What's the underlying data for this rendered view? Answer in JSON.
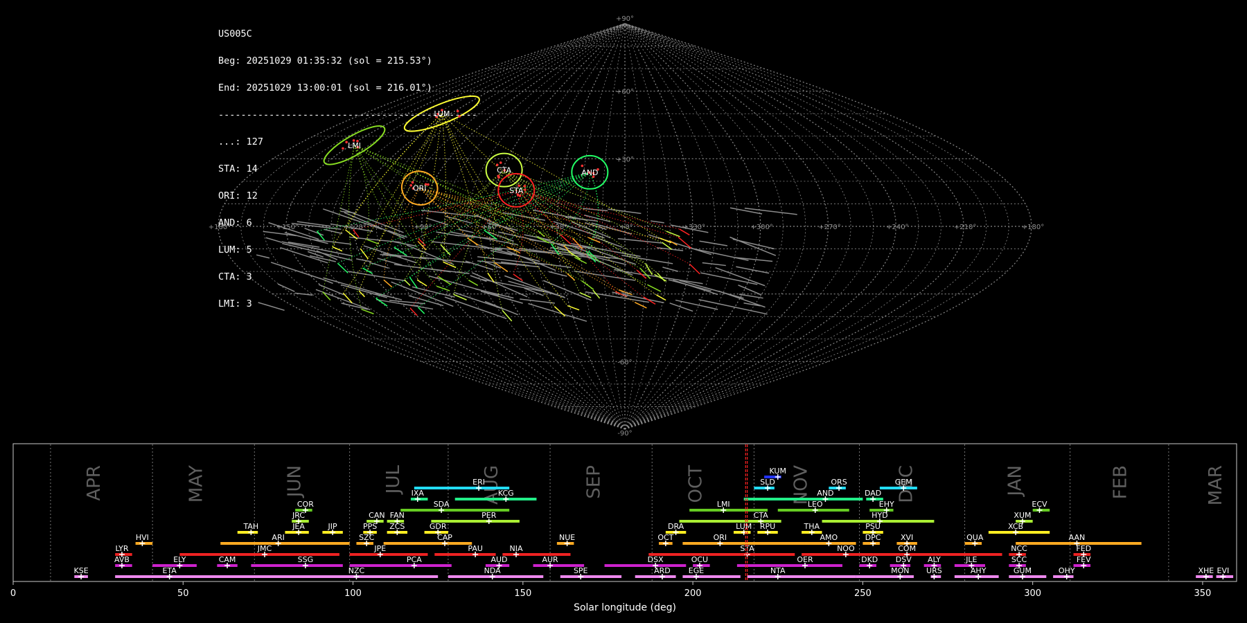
{
  "header": {
    "station": "US005C",
    "beg": "Beg: 20251029 01:35:32 (sol = 215.53°)",
    "end": "End: 20251029 13:00:01 (sol = 216.01°)",
    "divider": "----------------------------------------------",
    "counts": [
      {
        "label": "...: 127"
      },
      {
        "label": "STA: 14"
      },
      {
        "label": "ORI: 12"
      },
      {
        "label": "AND: 6"
      },
      {
        "label": "LUM: 5"
      },
      {
        "label": "CTA: 3"
      },
      {
        "label": "LMI: 3"
      }
    ]
  },
  "chart_data": [
    {
      "type": "scatter",
      "projection": "sinusoidal",
      "lon_ticks": [
        "+180°",
        "+150°",
        "+120°",
        "+90°",
        "+60°",
        "+30°",
        "+0°",
        "+330°",
        "+300°",
        "+270°",
        "+240°",
        "+210°",
        "+180°"
      ],
      "lat_ticks": [
        "+90°",
        "+60°",
        "+30°",
        "-30°",
        "-60°",
        "-90°"
      ],
      "grid": true,
      "radiants": [
        {
          "name": "LUM",
          "lon": 126,
          "lat": 50,
          "color": "#ffff33"
        },
        {
          "name": "LMI",
          "lon": 148,
          "lat": 36,
          "color": "#88dd22"
        },
        {
          "name": "ORI",
          "lon": 95,
          "lat": 17,
          "color": "#ffaa22"
        },
        {
          "name": "CTA",
          "lon": 59,
          "lat": 25,
          "color": "#ccff44"
        },
        {
          "name": "STA",
          "lon": 50,
          "lat": 16,
          "color": "#ff2222"
        },
        {
          "name": "AND",
          "lon": 17,
          "lat": 24,
          "color": "#22ff66"
        }
      ]
    },
    {
      "type": "gantt",
      "xlabel": "Solar longitude (deg)",
      "xlim": [
        0,
        360
      ],
      "xticks": [
        0,
        50,
        100,
        150,
        200,
        250,
        300,
        350
      ],
      "current_sol": [
        215.53,
        216.01
      ],
      "months": [
        {
          "name": "APR",
          "label_at": 24,
          "line_at": 11
        },
        {
          "name": "MAY",
          "label_at": 54,
          "line_at": 41
        },
        {
          "name": "JUN",
          "label_at": 83,
          "line_at": 71
        },
        {
          "name": "JUL",
          "label_at": 112,
          "line_at": 99
        },
        {
          "name": "AUG",
          "label_at": 141,
          "line_at": 128
        },
        {
          "name": "SEP",
          "label_at": 171,
          "line_at": 158
        },
        {
          "name": "OCT",
          "label_at": 201,
          "line_at": 188
        },
        {
          "name": "NOV",
          "label_at": 232,
          "line_at": 218
        },
        {
          "name": "DEC",
          "label_at": 263,
          "line_at": 249
        },
        {
          "name": "JAN",
          "label_at": 295,
          "line_at": 280
        },
        {
          "name": "FEB",
          "label_at": 326,
          "line_at": 311
        },
        {
          "name": "MAR",
          "label_at": 354,
          "line_at": 340
        }
      ],
      "showers": [
        {
          "code": "KUM",
          "start": 221,
          "end": 226,
          "peak": 225,
          "row": 9,
          "color": "#2233ff"
        },
        {
          "code": "ERI",
          "start": 118,
          "end": 146,
          "peak": 137,
          "row": 8,
          "color": "#22ddff"
        },
        {
          "code": "SLD",
          "start": 218,
          "end": 224,
          "peak": 222,
          "row": 8,
          "color": "#22ddff"
        },
        {
          "code": "ORS",
          "start": 240,
          "end": 245,
          "peak": 243,
          "row": 8,
          "color": "#22ddff"
        },
        {
          "code": "GEM",
          "start": 255,
          "end": 266,
          "peak": 262,
          "row": 8,
          "color": "#22ddff"
        },
        {
          "code": "IXA",
          "start": 117,
          "end": 122,
          "peak": 119,
          "row": 7,
          "color": "#22ee88"
        },
        {
          "code": "KCG",
          "start": 130,
          "end": 154,
          "peak": 145,
          "row": 7,
          "color": "#22ee88"
        },
        {
          "code": "AND",
          "start": 215,
          "end": 250,
          "peak": 239,
          "row": 7,
          "color": "#22ee88"
        },
        {
          "code": "DAD",
          "start": 251,
          "end": 256,
          "peak": 253,
          "row": 7,
          "color": "#22ee88"
        },
        {
          "code": "COR",
          "start": 83,
          "end": 88,
          "peak": 86,
          "row": 6,
          "color": "#66cc22"
        },
        {
          "code": "SDA",
          "start": 114,
          "end": 146,
          "peak": 126,
          "row": 6,
          "color": "#66cc22"
        },
        {
          "code": "LMI",
          "start": 199,
          "end": 222,
          "peak": 209,
          "row": 6,
          "color": "#66cc22"
        },
        {
          "code": "LEO",
          "start": 225,
          "end": 246,
          "peak": 236,
          "row": 6,
          "color": "#66cc22"
        },
        {
          "code": "EHY",
          "start": 252,
          "end": 259,
          "peak": 257,
          "row": 6,
          "color": "#66cc22"
        },
        {
          "code": "ECV",
          "start": 300,
          "end": 305,
          "peak": 302,
          "row": 6,
          "color": "#66cc22"
        },
        {
          "code": "JRC",
          "start": 82,
          "end": 87,
          "peak": 84,
          "row": 5,
          "color": "#aaee33"
        },
        {
          "code": "CAN",
          "start": 104,
          "end": 109,
          "peak": 107,
          "row": 5,
          "color": "#aaee33"
        },
        {
          "code": "FAN",
          "start": 110,
          "end": 115,
          "peak": 113,
          "row": 5,
          "color": "#aaee33"
        },
        {
          "code": "PER",
          "start": 123,
          "end": 149,
          "peak": 140,
          "row": 5,
          "color": "#aaee33"
        },
        {
          "code": "CTA",
          "start": 196,
          "end": 226,
          "peak": 220,
          "row": 5,
          "color": "#aaee33"
        },
        {
          "code": "HYD",
          "start": 238,
          "end": 271,
          "peak": 255,
          "row": 5,
          "color": "#aaee33"
        },
        {
          "code": "XUM",
          "start": 295,
          "end": 300,
          "peak": 297,
          "row": 5,
          "color": "#aaee33"
        },
        {
          "code": "TAH",
          "start": 66,
          "end": 72,
          "peak": 70,
          "row": 4,
          "color": "#ffee22"
        },
        {
          "code": "JEA",
          "start": 80,
          "end": 87,
          "peak": 84,
          "row": 4,
          "color": "#ffee22"
        },
        {
          "code": "JIP",
          "start": 91,
          "end": 97,
          "peak": 94,
          "row": 4,
          "color": "#ffee22"
        },
        {
          "code": "PPS",
          "start": 103,
          "end": 107,
          "peak": 105,
          "row": 4,
          "color": "#ffee22"
        },
        {
          "code": "ZCS",
          "start": 110,
          "end": 116,
          "peak": 113,
          "row": 4,
          "color": "#ffee22"
        },
        {
          "code": "GDR",
          "start": 121,
          "end": 128,
          "peak": 125,
          "row": 4,
          "color": "#ffee22"
        },
        {
          "code": "DRA",
          "start": 192,
          "end": 198,
          "peak": 195,
          "row": 4,
          "color": "#ffee22"
        },
        {
          "code": "LUM",
          "start": 212,
          "end": 217,
          "peak": 215,
          "row": 4,
          "color": "#ffee22"
        },
        {
          "code": "RPU",
          "start": 219,
          "end": 225,
          "peak": 222,
          "row": 4,
          "color": "#ffee22"
        },
        {
          "code": "THA",
          "start": 232,
          "end": 238,
          "peak": 235,
          "row": 4,
          "color": "#ffee22"
        },
        {
          "code": "PSU",
          "start": 250,
          "end": 256,
          "peak": 253,
          "row": 4,
          "color": "#ffee22"
        },
        {
          "code": "XCB",
          "start": 287,
          "end": 305,
          "peak": 295,
          "row": 4,
          "color": "#ffee22"
        },
        {
          "code": "HVI",
          "start": 36,
          "end": 41,
          "peak": 38,
          "row": 3,
          "color": "#ffaa22"
        },
        {
          "code": "ARI",
          "start": 61,
          "end": 99,
          "peak": 78,
          "row": 3,
          "color": "#ffaa22"
        },
        {
          "code": "SZC",
          "start": 101,
          "end": 106,
          "peak": 104,
          "row": 3,
          "color": "#ffaa22"
        },
        {
          "code": "CAP",
          "start": 109,
          "end": 135,
          "peak": 127,
          "row": 3,
          "color": "#ffaa22"
        },
        {
          "code": "NUE",
          "start": 160,
          "end": 165,
          "peak": 163,
          "row": 3,
          "color": "#ffaa22"
        },
        {
          "code": "OCT",
          "start": 190,
          "end": 194,
          "peak": 192,
          "row": 3,
          "color": "#ffaa22"
        },
        {
          "code": "ORI",
          "start": 197,
          "end": 233,
          "peak": 208,
          "row": 3,
          "color": "#ffaa22"
        },
        {
          "code": "AMO",
          "start": 233,
          "end": 248,
          "peak": 240,
          "row": 3,
          "color": "#ffaa22"
        },
        {
          "code": "DPC",
          "start": 250,
          "end": 255,
          "peak": 253,
          "row": 3,
          "color": "#ffaa22"
        },
        {
          "code": "XVI",
          "start": 260,
          "end": 266,
          "peak": 263,
          "row": 3,
          "color": "#ffaa22"
        },
        {
          "code": "QUA",
          "start": 280,
          "end": 285,
          "peak": 283,
          "row": 3,
          "color": "#ffaa22"
        },
        {
          "code": "AAN",
          "start": 295,
          "end": 332,
          "peak": 313,
          "row": 3,
          "color": "#ffaa22"
        },
        {
          "code": "LYR",
          "start": 30,
          "end": 35,
          "peak": 32,
          "row": 2,
          "color": "#ee2222"
        },
        {
          "code": "JMC",
          "start": 49,
          "end": 96,
          "peak": 74,
          "row": 2,
          "color": "#ee2222"
        },
        {
          "code": "JPE",
          "start": 99,
          "end": 122,
          "peak": 108,
          "row": 2,
          "color": "#ee2222"
        },
        {
          "code": "PAU",
          "start": 124,
          "end": 142,
          "peak": 136,
          "row": 2,
          "color": "#ee2222"
        },
        {
          "code": "NIA",
          "start": 144,
          "end": 164,
          "peak": 148,
          "row": 2,
          "color": "#ee2222"
        },
        {
          "code": "STA",
          "start": 187,
          "end": 230,
          "peak": 216,
          "row": 2,
          "color": "#ee2222"
        },
        {
          "code": "NOO",
          "start": 232,
          "end": 253,
          "peak": 245,
          "row": 2,
          "color": "#ee2222"
        },
        {
          "code": "COM",
          "start": 253,
          "end": 291,
          "peak": 263,
          "row": 2,
          "color": "#ee2222"
        },
        {
          "code": "NCC",
          "start": 293,
          "end": 298,
          "peak": 296,
          "row": 2,
          "color": "#ee2222"
        },
        {
          "code": "FED",
          "start": 312,
          "end": 317,
          "peak": 315,
          "row": 2,
          "color": "#ee2222"
        },
        {
          "code": "AVB",
          "start": 30,
          "end": 35,
          "peak": 32,
          "row": 1,
          "color": "#cc22cc"
        },
        {
          "code": "ELY",
          "start": 41,
          "end": 54,
          "peak": 49,
          "row": 1,
          "color": "#cc22cc"
        },
        {
          "code": "CAM",
          "start": 60,
          "end": 66,
          "peak": 63,
          "row": 1,
          "color": "#cc22cc"
        },
        {
          "code": "SSG",
          "start": 70,
          "end": 97,
          "peak": 86,
          "row": 1,
          "color": "#cc22cc"
        },
        {
          "code": "PCA",
          "start": 99,
          "end": 129,
          "peak": 118,
          "row": 1,
          "color": "#cc22cc"
        },
        {
          "code": "AUD",
          "start": 139,
          "end": 146,
          "peak": 143,
          "row": 1,
          "color": "#cc22cc"
        },
        {
          "code": "AUR",
          "start": 153,
          "end": 168,
          "peak": 158,
          "row": 1,
          "color": "#cc22cc"
        },
        {
          "code": "DSX",
          "start": 174,
          "end": 198,
          "peak": 189,
          "row": 1,
          "color": "#cc22cc"
        },
        {
          "code": "OCU",
          "start": 200,
          "end": 205,
          "peak": 202,
          "row": 1,
          "color": "#cc22cc"
        },
        {
          "code": "OER",
          "start": 213,
          "end": 244,
          "peak": 233,
          "row": 1,
          "color": "#cc22cc"
        },
        {
          "code": "DKD",
          "start": 249,
          "end": 254,
          "peak": 252,
          "row": 1,
          "color": "#cc22cc"
        },
        {
          "code": "DSV",
          "start": 258,
          "end": 264,
          "peak": 262,
          "row": 1,
          "color": "#cc22cc"
        },
        {
          "code": "ALY",
          "start": 268,
          "end": 273,
          "peak": 271,
          "row": 1,
          "color": "#cc22cc"
        },
        {
          "code": "JLE",
          "start": 277,
          "end": 286,
          "peak": 282,
          "row": 1,
          "color": "#cc22cc"
        },
        {
          "code": "SCC",
          "start": 293,
          "end": 298,
          "peak": 296,
          "row": 1,
          "color": "#cc22cc"
        },
        {
          "code": "FEV",
          "start": 312,
          "end": 317,
          "peak": 315,
          "row": 1,
          "color": "#cc22cc"
        },
        {
          "code": "KSE",
          "start": 18,
          "end": 22,
          "peak": 20,
          "row": 0,
          "color": "#ee88ee"
        },
        {
          "code": "ETA",
          "start": 30,
          "end": 66,
          "peak": 46,
          "row": 0,
          "color": "#ee88ee"
        },
        {
          "code": "NZC",
          "start": 64,
          "end": 125,
          "peak": 101,
          "row": 0,
          "color": "#ee88ee"
        },
        {
          "code": "NDA",
          "start": 128,
          "end": 156,
          "peak": 141,
          "row": 0,
          "color": "#ee88ee"
        },
        {
          "code": "SPE",
          "start": 161,
          "end": 179,
          "peak": 167,
          "row": 0,
          "color": "#ee88ee"
        },
        {
          "code": "ARD",
          "start": 183,
          "end": 195,
          "peak": 191,
          "row": 0,
          "color": "#ee88ee"
        },
        {
          "code": "EGE",
          "start": 197,
          "end": 214,
          "peak": 201,
          "row": 0,
          "color": "#ee88ee"
        },
        {
          "code": "NTA",
          "start": 216,
          "end": 248,
          "peak": 225,
          "row": 0,
          "color": "#ee88ee"
        },
        {
          "code": "MON",
          "start": 248,
          "end": 265,
          "peak": 261,
          "row": 0,
          "color": "#ee88ee"
        },
        {
          "code": "URS",
          "start": 270,
          "end": 273,
          "peak": 271,
          "row": 0,
          "color": "#ee88ee"
        },
        {
          "code": "AHY",
          "start": 277,
          "end": 290,
          "peak": 284,
          "row": 0,
          "color": "#ee88ee"
        },
        {
          "code": "GUM",
          "start": 293,
          "end": 304,
          "peak": 297,
          "row": 0,
          "color": "#ee88ee"
        },
        {
          "code": "OHY",
          "start": 306,
          "end": 312,
          "peak": 310,
          "row": 0,
          "color": "#ee88ee"
        },
        {
          "code": "XHE",
          "start": 348,
          "end": 353,
          "peak": 351,
          "row": 0,
          "color": "#ee88ee"
        },
        {
          "code": "EVI",
          "start": 354,
          "end": 359,
          "peak": 356,
          "row": 0,
          "color": "#ee88ee"
        }
      ]
    }
  ]
}
